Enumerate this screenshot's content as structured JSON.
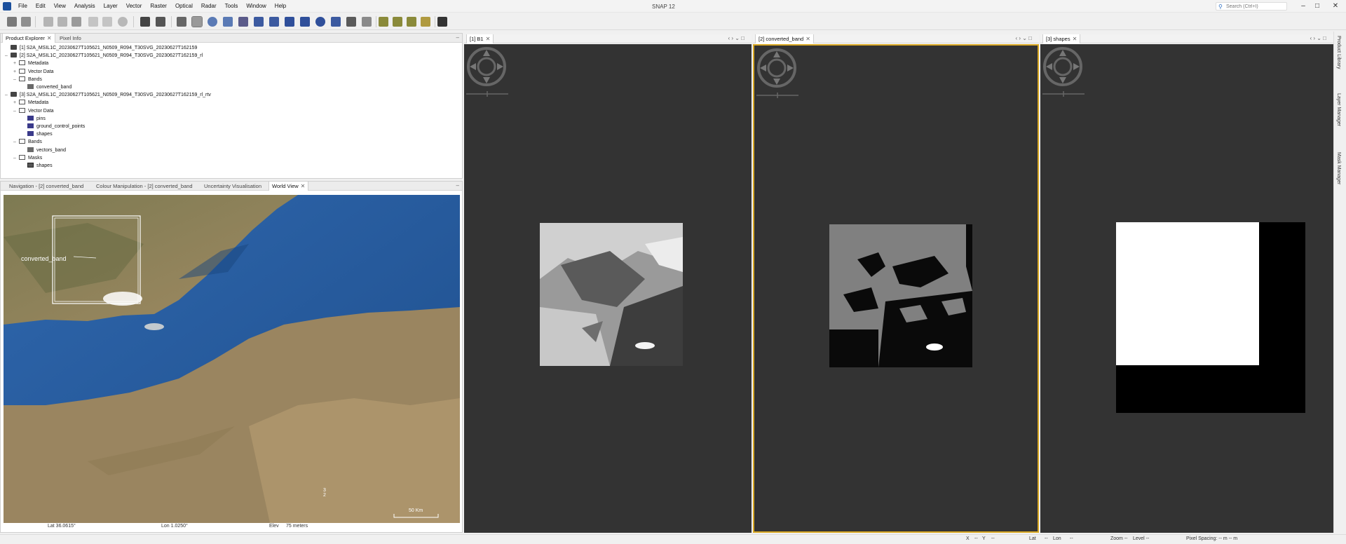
{
  "window": {
    "title": "SNAP 12",
    "search_placeholder": "Search (Ctrl+I)"
  },
  "menu": [
    "File",
    "Edit",
    "View",
    "Analysis",
    "Layer",
    "Vector",
    "Raster",
    "Optical",
    "Radar",
    "Tools",
    "Window",
    "Help"
  ],
  "product_explorer": {
    "tabs": [
      "Product Explorer",
      "Pixel Info"
    ],
    "tree": [
      {
        "label": "[1] S2A_MSIL1C_20230627T105621_N0509_R094_T30SVG_20230627T162159",
        "icon": "product-icon",
        "indent": 0,
        "expander": ""
      },
      {
        "label": "[2] S2A_MSIL1C_20230627T105621_N0509_R094_T30SVG_20230627T162159_rl",
        "icon": "product-icon",
        "indent": 0,
        "expander": "–"
      },
      {
        "label": "Metadata",
        "icon": "folder-icon",
        "indent": 1,
        "expander": "+"
      },
      {
        "label": "Vector Data",
        "icon": "folder-icon",
        "indent": 1,
        "expander": "+"
      },
      {
        "label": "Bands",
        "icon": "folder-icon",
        "indent": 1,
        "expander": "–"
      },
      {
        "label": "converted_band",
        "icon": "band-icon",
        "indent": 2,
        "expander": ""
      },
      {
        "label": "[3] S2A_MSIL1C_20230627T105621_N0509_R094_T30SVG_20230627T162159_rl_rtv",
        "icon": "product-icon",
        "indent": 0,
        "expander": "–"
      },
      {
        "label": "Metadata",
        "icon": "folder-icon",
        "indent": 1,
        "expander": "+"
      },
      {
        "label": "Vector Data",
        "icon": "folder-icon",
        "indent": 1,
        "expander": "–"
      },
      {
        "label": "pins",
        "icon": "vector-icon",
        "indent": 2,
        "expander": ""
      },
      {
        "label": "ground_control_points",
        "icon": "vector-icon",
        "indent": 2,
        "expander": ""
      },
      {
        "label": "shapes",
        "icon": "vector-icon",
        "indent": 2,
        "expander": ""
      },
      {
        "label": "Bands",
        "icon": "folder-icon",
        "indent": 1,
        "expander": "–"
      },
      {
        "label": "vectors_band",
        "icon": "band-icon",
        "indent": 2,
        "expander": ""
      },
      {
        "label": "Masks",
        "icon": "folder-icon",
        "indent": 1,
        "expander": "–"
      },
      {
        "label": "shapes",
        "icon": "mask-icon",
        "indent": 2,
        "expander": ""
      }
    ]
  },
  "tool_panel": {
    "tabs": [
      "Navigation - [2] converted_band",
      "Colour Manipulation - [2] converted_band",
      "Uncertainty Visualisation",
      "World View"
    ],
    "world_view": {
      "overlay_label": "converted_band",
      "scale_label": "50 Km",
      "status_lat": "Lat 36.0615°",
      "status_lon": "Lon 1.0250°",
      "status_elev": "Elev",
      "status_elev_value": "75 meters"
    }
  },
  "image_windows": [
    {
      "tab": "[1] B1",
      "image": "b1"
    },
    {
      "tab": "[2] converted_band",
      "image": "converted"
    },
    {
      "tab": "[3] shapes",
      "image": "shapes"
    }
  ],
  "right_tabs": [
    "Product Library",
    "Layer Manager",
    "Mask Manager"
  ],
  "statusbar": {
    "x": "X",
    "x_val": "--",
    "y": "Y",
    "y_val": "--",
    "lat": "Lat",
    "lat_val": "--",
    "lon": "Lon",
    "lon_val": "--",
    "zoom": "Zoom --",
    "level": "Level --",
    "pixel_spacing": "Pixel Spacing: -- m -- m"
  },
  "colors": {
    "accent": "#d9a823",
    "canvas": "#333333",
    "sea": "#2a5d9c",
    "land": "#8a7a55"
  }
}
